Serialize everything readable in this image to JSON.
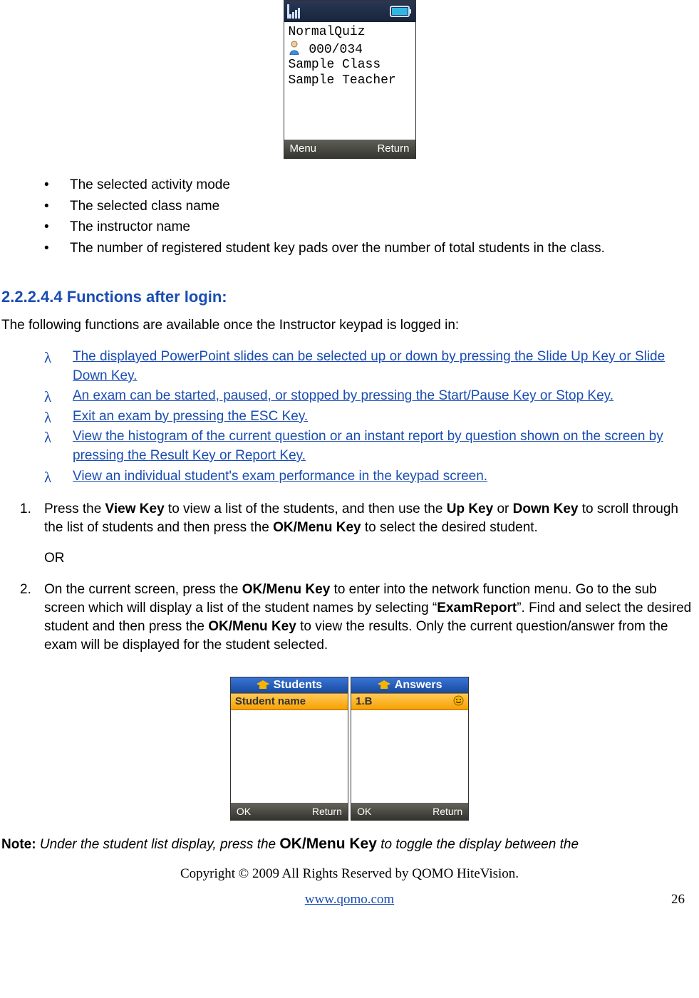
{
  "phone1": {
    "quiz_mode": "NormalQuiz",
    "counts": "000/034",
    "class_name": "Sample Class",
    "teacher_name": "Sample Teacher",
    "soft_left": "Menu",
    "soft_right": "Return"
  },
  "bullets": [
    "The selected activity mode",
    "The selected class name",
    "The instructor name",
    "The number of registered student key pads over the number of total students in the class."
  ],
  "section_heading": "2.2.2.4.4  Functions after login:",
  "intro": "The following functions are available once the Instructor keypad is logged in:",
  "lambda_items": [
    "The displayed PowerPoint slides can be selected up or down by pressing the Slide Up Key or Slide Down Key.",
    "An exam can be started, paused, or stopped by pressing the Start/Pause Key or Stop Key.",
    "Exit an exam by pressing the ESC Key.",
    "View the histogram of the current question or an instant report by question shown on the screen by pressing the Result Key or Report Key.",
    "View an individual student's exam performance in the keypad screen."
  ],
  "numbered_items": {
    "item1_parts": [
      "Press the ",
      "View Key",
      " to view a list of the students, and then use the ",
      "Up Key",
      " or ",
      "Down Key",
      " to scroll through the list of students and then press the ",
      "OK/Menu Key",
      " to select the desired student."
    ],
    "or_label": "OR",
    "item2_parts": [
      "On the current screen, press the ",
      "OK/Menu Key",
      " to enter into the network function menu. Go to the sub screen which will display a list of the student names by selecting “",
      "ExamReport",
      "”. Find and select the desired student and then press the ",
      "OK/Menu Key",
      " to view the results. Only the current question/answer from the exam will be displayed for the student selected."
    ]
  },
  "twin": {
    "left": {
      "title": "Students",
      "selected": "Student name",
      "soft_left": "OK",
      "soft_right": "Return"
    },
    "right": {
      "title": "Answers",
      "selected": "1.B",
      "soft_left": "OK",
      "soft_right": "Return"
    }
  },
  "note": {
    "lead": "Note:",
    "rest_parts": [
      " Under the student list display, press the ",
      "OK/Menu Key",
      " to toggle the display between the "
    ]
  },
  "footer": {
    "copyright": "Copyright © 2009 All Rights Reserved by QOMO HiteVision.",
    "url_text": "www.qomo.com",
    "page_number": "26"
  }
}
